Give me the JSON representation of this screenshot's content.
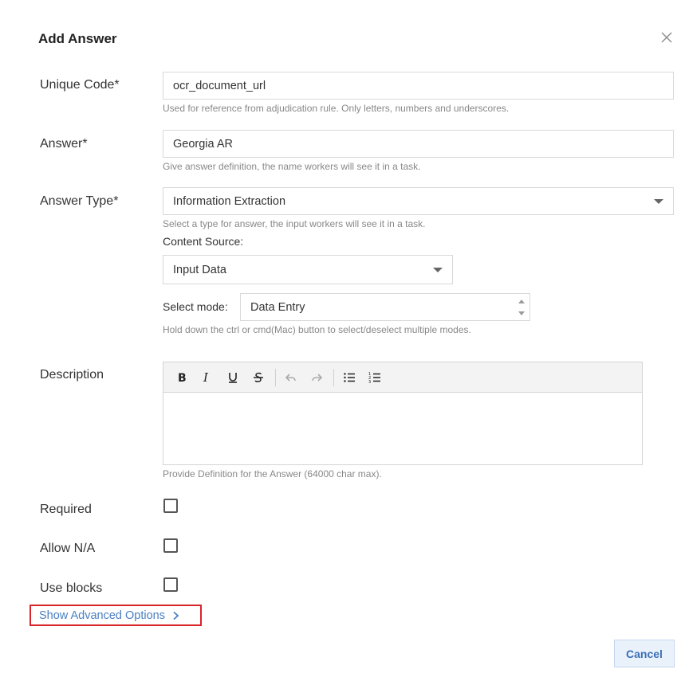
{
  "dialog": {
    "title": "Add Answer"
  },
  "fields": {
    "unique_code": {
      "label": "Unique Code*",
      "value": "ocr_document_url",
      "hint": "Used for reference from adjudication rule. Only letters, numbers and underscores."
    },
    "answer": {
      "label": "Answer*",
      "value": "Georgia AR",
      "hint": "Give answer definition, the name workers will see it in a task."
    },
    "answer_type": {
      "label": "Answer Type*",
      "value": "Information Extraction",
      "hint": "Select a type for answer, the input workers will see it in a task."
    },
    "content_source": {
      "label": "Content Source:",
      "value": "Input Data"
    },
    "select_mode": {
      "label": "Select mode:",
      "value": "Data Entry",
      "hint": "Hold down the ctrl or cmd(Mac) button to select/deselect multiple modes."
    },
    "description": {
      "label": "Description",
      "hint": "Provide Definition for the Answer (64000 char max)."
    },
    "required": {
      "label": "Required"
    },
    "allow_na": {
      "label": "Allow N/A"
    },
    "use_blocks": {
      "label": "Use blocks"
    }
  },
  "toolbar": {
    "icons": [
      "bold-icon",
      "italic-icon",
      "underline-icon",
      "strikethrough-icon",
      "undo-icon",
      "redo-icon",
      "bullet-list-icon",
      "numbered-list-icon"
    ]
  },
  "advanced": {
    "label": "Show Advanced Options"
  },
  "footer": {
    "cancel_label": "Cancel"
  },
  "colors": {
    "link": "#4a7fc1",
    "highlight": "#d9252a",
    "cancel_bg": "#e9f1fb"
  }
}
